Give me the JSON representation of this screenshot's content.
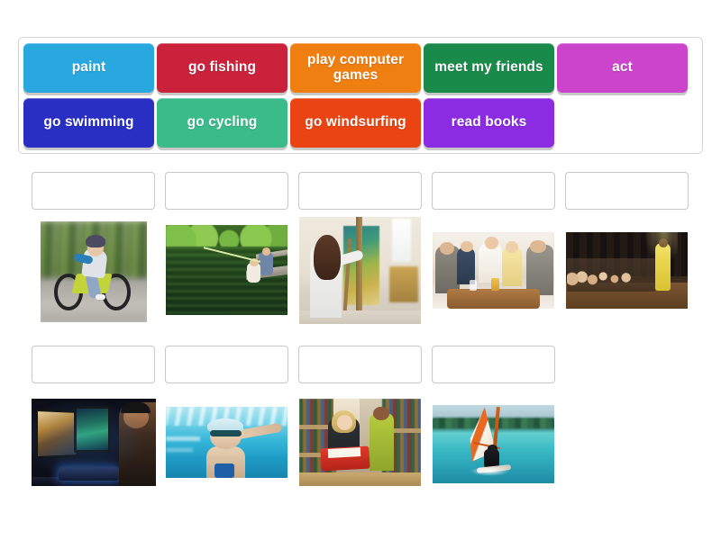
{
  "activity": {
    "type": "drag-and-drop-match-up",
    "tile_bank": {
      "name": "word-tile-bank",
      "rows": [
        [
          {
            "label": "paint",
            "color": "#29a8e0"
          },
          {
            "label": "go fishing",
            "color": "#c9223a"
          },
          {
            "label": "play computer games",
            "color": "#f07f12"
          },
          {
            "label": "meet my friends",
            "color": "#1a8a4a"
          },
          {
            "label": "act",
            "color": "#cc44cc"
          }
        ],
        [
          {
            "label": "go swimming",
            "color": "#2a2fc4"
          },
          {
            "label": "go cycling",
            "color": "#3cbb8a"
          },
          {
            "label": "go windsurfing",
            "color": "#ea4412"
          },
          {
            "label": "read books",
            "color": "#8b2be2"
          },
          {
            "label": "",
            "color": "transparent",
            "empty": true
          }
        ]
      ]
    },
    "answer_rows": [
      {
        "dropzones": [
          {
            "label": "",
            "placeholder": ""
          },
          {
            "label": "",
            "placeholder": ""
          },
          {
            "label": "",
            "placeholder": ""
          },
          {
            "label": "",
            "placeholder": ""
          },
          {
            "label": "",
            "placeholder": ""
          }
        ],
        "images": [
          {
            "alt": "boy riding a bicycle on a road",
            "icon": "cycling-photo",
            "match": "go cycling"
          },
          {
            "alt": "father and child fishing from a wooden dock on a green pond",
            "icon": "fishing-photo",
            "match": "go fishing"
          },
          {
            "alt": "woman painting a canvas on an easel in an art studio",
            "icon": "painting-photo",
            "match": "paint"
          },
          {
            "alt": "group of friends laughing around a table with drinks",
            "icon": "friends-photo",
            "match": "meet my friends"
          },
          {
            "alt": "children sitting on a stage with a performer in yellow",
            "icon": "acting-photo",
            "match": "act"
          }
        ]
      },
      {
        "dropzones": [
          {
            "label": "",
            "placeholder": ""
          },
          {
            "label": "",
            "placeholder": ""
          },
          {
            "label": "",
            "placeholder": ""
          },
          {
            "label": "",
            "placeholder": ""
          }
        ],
        "images": [
          {
            "alt": "gamer with headphones at a multi-monitor computer setup",
            "icon": "computer-games-photo",
            "match": "play computer games"
          },
          {
            "alt": "swimmer with goggles underwater in a pool",
            "icon": "swimming-photo",
            "match": "go swimming"
          },
          {
            "alt": "woman reading a red book in a library",
            "icon": "reading-photo",
            "match": "read books"
          },
          {
            "alt": "windsurfer with orange and white sail on turquoise water",
            "icon": "windsurfing-photo",
            "match": "go windsurfing"
          }
        ]
      }
    ]
  }
}
